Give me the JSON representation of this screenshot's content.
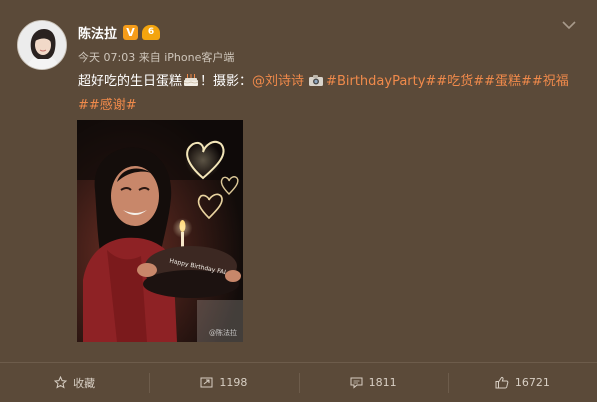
{
  "post": {
    "username": "陈法拉",
    "verified_badge": "V",
    "member_badge": "6",
    "time": "今天 07:03",
    "source_prefix": "来自",
    "source": "iPhone客户端",
    "text_before_cake": "超好吃的生日蛋糕",
    "text_after_cake": "！摄影：",
    "mention": "@刘诗诗",
    "hashtags_line1": "#BirthdayParty##吃货##蛋糕##祝福",
    "hashtags_line2": "##感谢#",
    "photo_watermark": "@陈法拉",
    "cake_text": "Happy Birthday FALA"
  },
  "actions": {
    "favorite": "收藏",
    "repost": "1198",
    "comment": "1811",
    "like": "16721"
  },
  "icons": {
    "chevron": "chevron-down-icon",
    "cake": "cake-emoji-icon",
    "camera": "camera-emoji-icon",
    "favorite": "star-icon",
    "repost": "repost-icon",
    "comment": "comment-icon",
    "like": "thumbs-up-icon"
  },
  "colors": {
    "background": "#5b4a39",
    "link": "#f08a4b",
    "verified": "#f59c1a"
  }
}
